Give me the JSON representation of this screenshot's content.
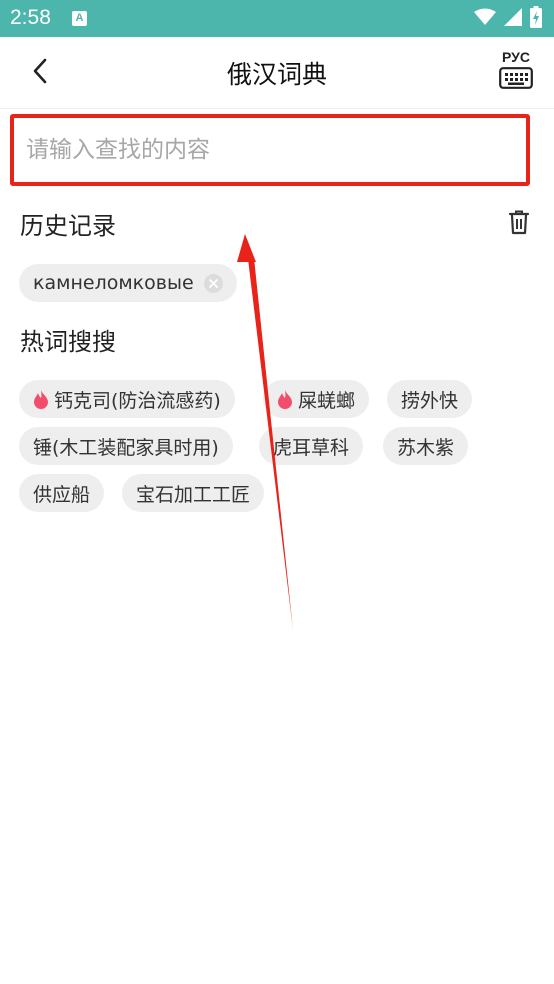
{
  "status_bar": {
    "time": "2:58",
    "app_icon_letter": "A"
  },
  "header": {
    "title": "俄汉词典",
    "keyboard_label": "РУС"
  },
  "search": {
    "placeholder": "请输入查找的内容",
    "value": ""
  },
  "history": {
    "title": "历史记录",
    "items": [
      {
        "label": "камнеломковые"
      }
    ]
  },
  "hot_search": {
    "title": "热词搜搜",
    "items": [
      {
        "label": "钙克司(防治流感药)",
        "hot": true
      },
      {
        "label": "屎蜣螂",
        "hot": true
      },
      {
        "label": "捞外快",
        "hot": false
      },
      {
        "label": "锤(木工装配家具时用)",
        "hot": false
      },
      {
        "label": "虎耳草科",
        "hot": false
      },
      {
        "label": "苏木紫",
        "hot": false
      },
      {
        "label": "供应船",
        "hot": false
      },
      {
        "label": "宝石加工工匠",
        "hot": false
      }
    ]
  },
  "colors": {
    "status_bar": "#4db6ac",
    "highlight_red": "#e8231a",
    "flame": "#f24e6b",
    "chip_bg": "#eeeeee"
  }
}
